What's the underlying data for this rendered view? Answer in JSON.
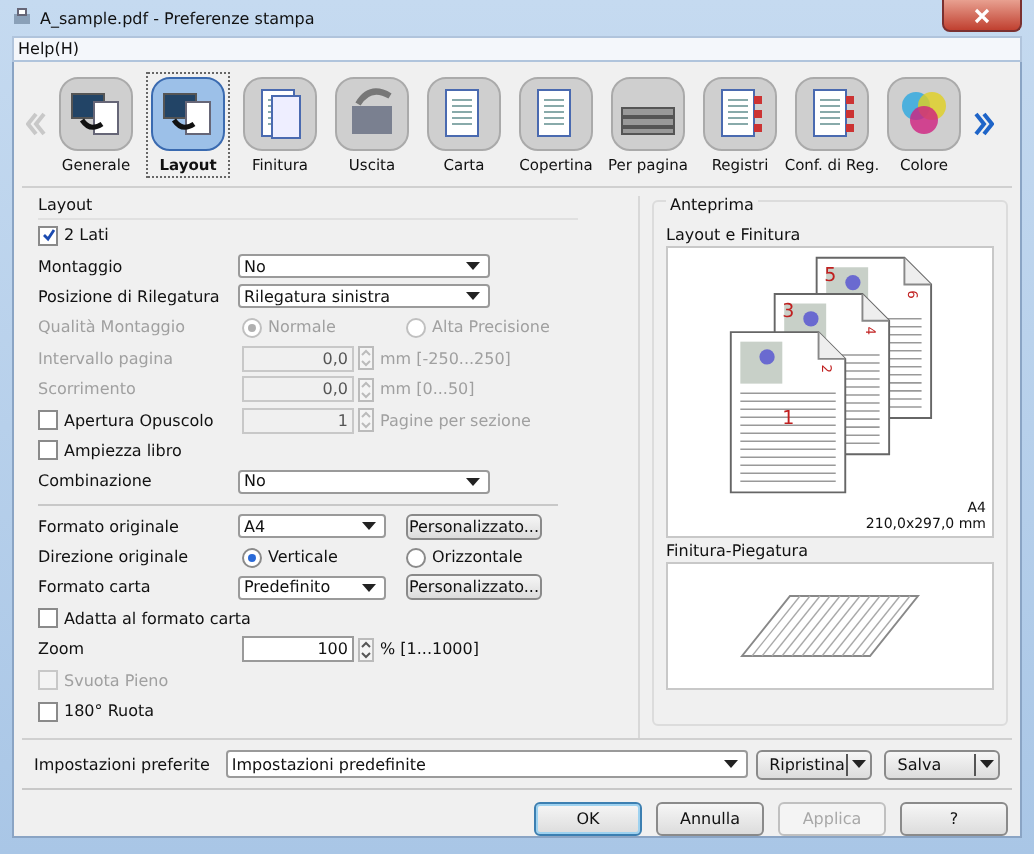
{
  "window": {
    "title": "A_sample.pdf - Preferenze stampa"
  },
  "menu": [
    "Help(H)"
  ],
  "tabs": [
    {
      "label": "Generale",
      "selected": false
    },
    {
      "label": "Layout",
      "selected": true
    },
    {
      "label": "Finitura",
      "selected": false
    },
    {
      "label": "Uscita",
      "selected": false
    },
    {
      "label": "Carta",
      "selected": false
    },
    {
      "label": "Copertina",
      "selected": false
    },
    {
      "label": "Per pagina",
      "selected": false
    },
    {
      "label": "Registri",
      "selected": false
    },
    {
      "label": "Conf. di Reg.",
      "selected": false
    },
    {
      "label": "Colore",
      "selected": false
    }
  ],
  "layout": {
    "title": "Layout",
    "rows": [
      {
        "kind": "checkbox",
        "label": "2 Lati",
        "checked": true,
        "disabled": false
      },
      {
        "kind": "select",
        "label": "Montaggio",
        "value": "No"
      },
      {
        "kind": "select",
        "label": "Posizione di Rilegatura",
        "value": "Rilegatura sinistra"
      },
      {
        "kind": "radio",
        "label": "Qualità Montaggio",
        "disabled": true,
        "options": [
          {
            "label": "Normale",
            "selected": true
          },
          {
            "label": "Alta Precisione",
            "selected": false
          }
        ]
      },
      {
        "kind": "spin",
        "label": "Intervallo pagina",
        "value": "0,0",
        "unit": "mm [-250...250]",
        "disabled": true
      },
      {
        "kind": "spin",
        "label": "Scorrimento",
        "value": "0,0",
        "unit": "mm [0...50]",
        "disabled": true
      },
      {
        "kind": "check-spin",
        "label": "Apertura Opuscolo",
        "checked": false,
        "value": "1",
        "unit": "Pagine per sezione",
        "disabled": true
      },
      {
        "kind": "checkbox",
        "label": "Ampiezza libro",
        "checked": false,
        "disabled": false
      },
      {
        "kind": "select",
        "label": "Combinazione",
        "value": "No"
      },
      {
        "kind": "divider"
      },
      {
        "kind": "select",
        "label": "Formato originale",
        "value": "A4",
        "button": "Personalizzato..."
      },
      {
        "kind": "radio",
        "label": "Direzione originale",
        "disabled": false,
        "options": [
          {
            "label": "Verticale",
            "selected": true
          },
          {
            "label": "Orizzontale",
            "selected": false
          }
        ]
      },
      {
        "kind": "select",
        "label": "Formato carta",
        "value": "Predefinito",
        "button": "Personalizzato..."
      },
      {
        "kind": "checkbox",
        "label": "Adatta al formato carta",
        "checked": false,
        "disabled": false
      },
      {
        "kind": "spin",
        "label": "Zoom",
        "value": "100",
        "unit": "% [1...1000]",
        "disabled": false
      },
      {
        "kind": "checkbox",
        "label": "Svuota Pieno",
        "checked": false,
        "disabled": true
      },
      {
        "kind": "checkbox",
        "label": "180° Ruota",
        "checked": false,
        "disabled": false
      }
    ]
  },
  "preview": {
    "title": "Anteprima",
    "layout_label": "Layout e Finitura",
    "page_numbers": [
      "1",
      "2",
      "3",
      "4",
      "5",
      "6"
    ],
    "paper_size": "A4",
    "paper_dimensions": "210,0x297,0 mm",
    "finishing_label": "Finitura-Piegatura"
  },
  "favorites": {
    "label": "Impostazioni preferite",
    "value": "Impostazioni predefinite",
    "buttons": [
      "Ripristina",
      "Salva"
    ]
  },
  "buttons": [
    {
      "label": "OK",
      "disabled": false,
      "default": true
    },
    {
      "label": "Annulla",
      "disabled": false,
      "default": false
    },
    {
      "label": "Applica",
      "disabled": true,
      "default": false
    },
    {
      "label": "?",
      "disabled": false,
      "default": false
    }
  ]
}
